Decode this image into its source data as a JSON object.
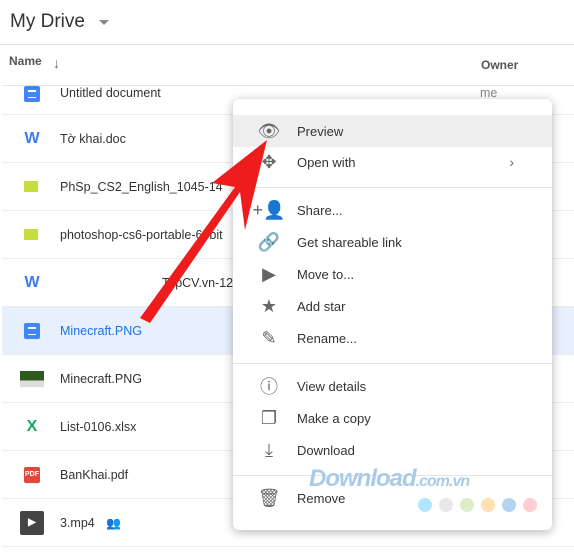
{
  "header": {
    "title": "My Drive"
  },
  "columns": {
    "name": "Name",
    "owner": "Owner"
  },
  "files": [
    {
      "name": "Untitled document",
      "owner": "me",
      "icon": "doc-icon"
    },
    {
      "name": "Tờ khai.doc",
      "icon": "word-icon"
    },
    {
      "name": "PhSp_CS2_English_1045-14",
      "icon": "archive-icon"
    },
    {
      "name": "photoshop-cs6-portable-64bit",
      "icon": "archive-icon"
    },
    {
      "name": "TopCV.vn-12",
      "icon": "word-icon"
    },
    {
      "name": "Minecraft.PNG",
      "icon": "doc-icon",
      "selected": true
    },
    {
      "name": "Minecraft.PNG",
      "icon": "image-thumbnail"
    },
    {
      "name": "List-0106.xlsx",
      "icon": "excel-icon"
    },
    {
      "name": "BanKhai.pdf",
      "icon": "pdf-icon"
    },
    {
      "name": "3.mp4",
      "icon": "video-thumbnail",
      "shared": true
    }
  ],
  "menu": {
    "preview": "Preview",
    "open_with": "Open with",
    "share": "Share...",
    "link": "Get shareable link",
    "move": "Move to...",
    "star": "Add star",
    "rename": "Rename...",
    "details": "View details",
    "copy": "Make a copy",
    "download": "Download",
    "remove": "Remove"
  },
  "watermark": {
    "text": "Download",
    "suffix": ".com.vn",
    "dots": [
      "#b3e5fc",
      "#e8e8e8",
      "#dcedc8",
      "#ffe0b2",
      "#b3d4ee",
      "#ffcdd2"
    ]
  },
  "colors": {
    "accent": "#1a73e8",
    "selected_row": "#e8f0fe",
    "arrow": "#ee1c1c"
  }
}
